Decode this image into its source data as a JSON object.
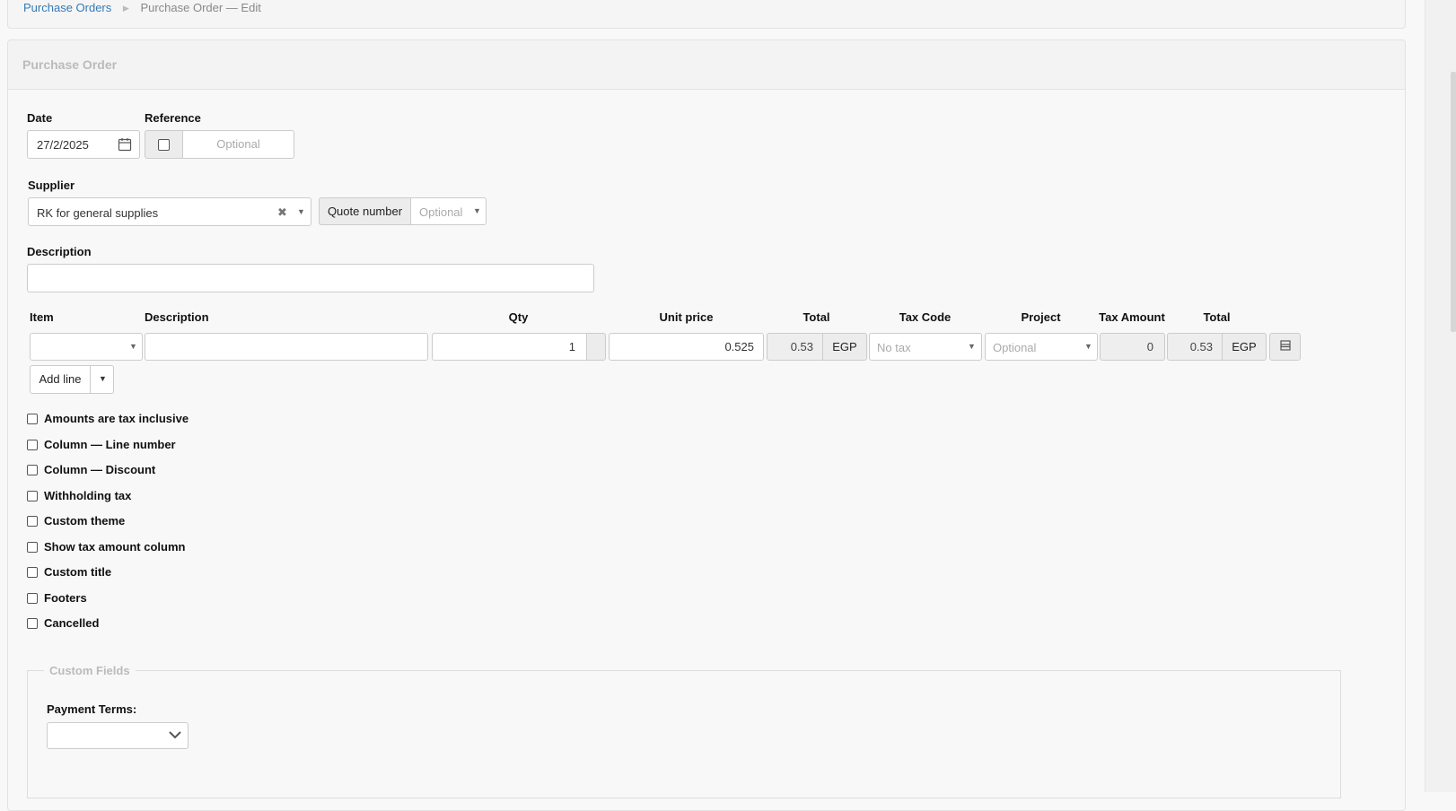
{
  "breadcrumb": {
    "parent": "Purchase Orders",
    "current": "Purchase Order — Edit"
  },
  "panel": {
    "title": "Purchase Order"
  },
  "form": {
    "date_label": "Date",
    "date_value": "27/2/2025",
    "reference_label": "Reference",
    "reference_placeholder": "Optional",
    "supplier_label": "Supplier",
    "supplier_value": "RK for general supplies",
    "quote_number_label": "Quote number",
    "quote_number_placeholder": "Optional",
    "description_label": "Description",
    "description_value": ""
  },
  "lines": {
    "headers": {
      "item": "Item",
      "description": "Description",
      "qty": "Qty",
      "unit_price": "Unit price",
      "total": "Total",
      "tax_code": "Tax Code",
      "project": "Project",
      "tax_amount": "Tax Amount",
      "total2": "Total"
    },
    "rows": [
      {
        "item": "",
        "description": "",
        "qty": "1",
        "unit_price": "0.525",
        "total": "0.53",
        "currency": "EGP",
        "tax_code": "No tax",
        "project": "Optional",
        "tax_amount": "0",
        "total2": "0.53",
        "currency2": "EGP"
      }
    ],
    "add_line_label": "Add line"
  },
  "options": [
    "Amounts are tax inclusive",
    "Column — Line number",
    "Column — Discount",
    "Withholding tax",
    "Custom theme",
    "Show tax amount column",
    "Custom title",
    "Footers",
    "Cancelled"
  ],
  "custom_fields": {
    "legend": "Custom Fields",
    "payment_terms_label": "Payment Terms:",
    "payment_terms_value": ""
  },
  "colors": {
    "link": "#337ab7",
    "panel_bg": "#f8f8f8",
    "border": "#cccccc"
  }
}
